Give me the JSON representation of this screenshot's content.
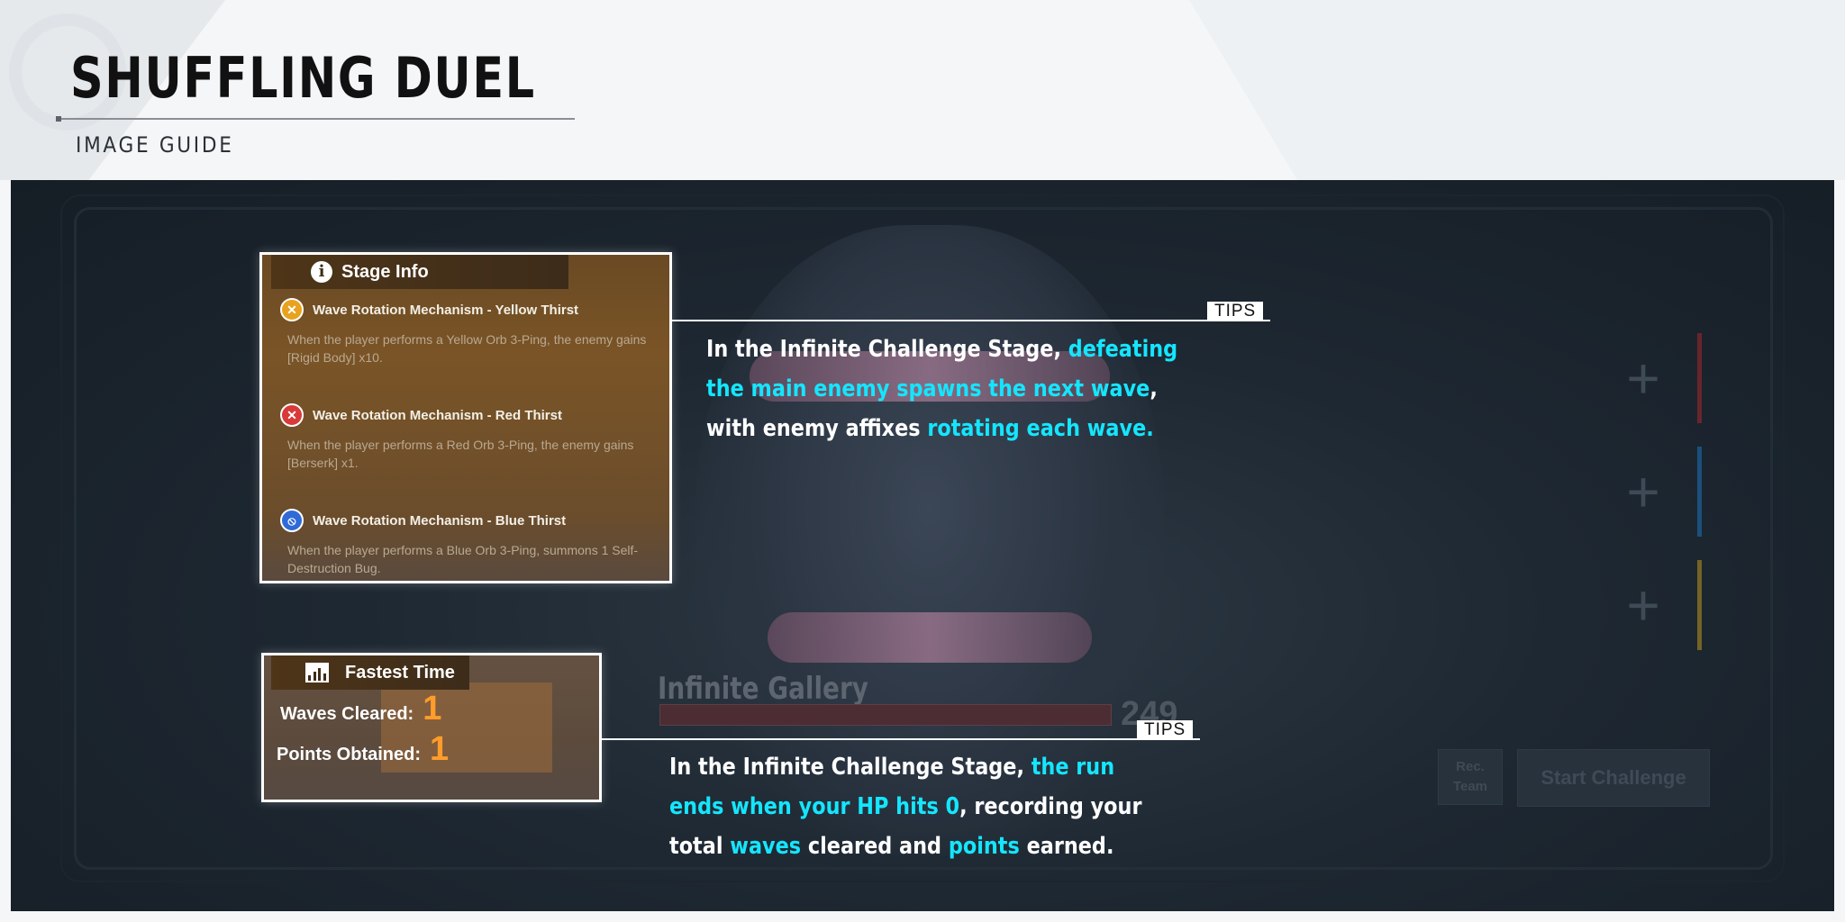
{
  "page": {
    "title": "SHUFFLING DUEL",
    "subtitle": "IMAGE GUIDE"
  },
  "stage_info": {
    "header": "Stage Info",
    "icon": "info-icon",
    "mechanisms": [
      {
        "icon": "yellow-thirst-icon",
        "color": "#e8a21f",
        "title": "Wave Rotation Mechanism - Yellow Thirst",
        "description": "When the player performs a Yellow Orb 3-Ping, the enemy gains [Rigid Body] x10."
      },
      {
        "icon": "red-thirst-icon",
        "color": "#d83a3a",
        "title": "Wave Rotation Mechanism - Red Thirst",
        "description": "When the player performs a Red Orb 3-Ping, the enemy gains [Berserk] x1."
      },
      {
        "icon": "blue-thirst-icon",
        "color": "#2f6ad8",
        "title": "Wave Rotation Mechanism - Blue Thirst",
        "description": "When the player performs a Blue Orb 3-Ping, summons 1 Self-Destruction Bug."
      }
    ]
  },
  "fastest_time": {
    "header": "Fastest Time",
    "icon": "chart-icon",
    "waves_label": "Waves Cleared:",
    "waves_value": "1",
    "points_label": "Points Obtained:",
    "points_value": "1"
  },
  "tips": [
    {
      "badge": "TIPS",
      "segments": [
        {
          "text": "In the Infinite Challenge Stage, ",
          "highlight": false
        },
        {
          "text": "defeating the main enemy spawns the next wave",
          "highlight": true
        },
        {
          "text": ", with enemy affixes ",
          "highlight": false
        },
        {
          "text": "rotating each wave.",
          "highlight": true
        }
      ]
    },
    {
      "badge": "TIPS",
      "segments": [
        {
          "text": "In the Infinite Challenge Stage, ",
          "highlight": false
        },
        {
          "text": "the run ends when your HP hits 0",
          "highlight": true
        },
        {
          "text": ", recording your total ",
          "highlight": false
        },
        {
          "text": "waves",
          "highlight": true
        },
        {
          "text": " cleared and ",
          "highlight": false
        },
        {
          "text": "points",
          "highlight": true
        },
        {
          "text": " earned.",
          "highlight": false
        }
      ]
    }
  ],
  "background_ui": {
    "gallery_title": "Infinite Gallery",
    "hp_value": "249",
    "rec_team": "Rec. Team",
    "start_challenge": "Start Challenge",
    "slot_colors": [
      "#b8262c",
      "#1c7ac9",
      "#c9a21c"
    ]
  },
  "colors": {
    "highlight": "#14e6ff",
    "accent_orange": "#ff9d2a"
  }
}
